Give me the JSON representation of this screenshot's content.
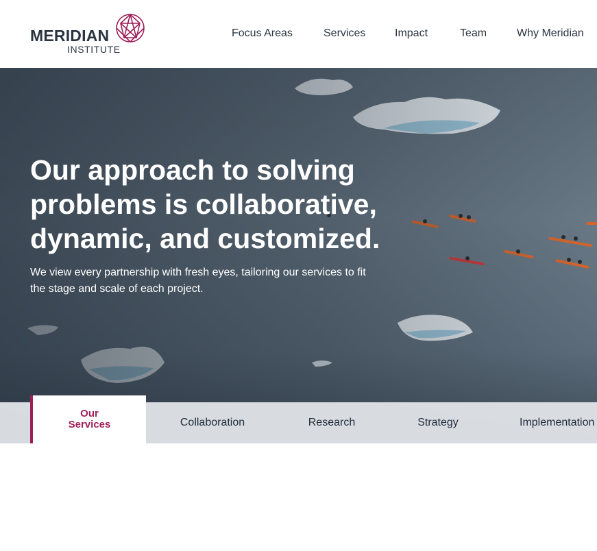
{
  "brand": {
    "name": "MERIDIAN",
    "sub": "INSTITUTE",
    "accent_color": "#9c1f5a"
  },
  "nav": {
    "items": [
      {
        "label": "Focus Areas"
      },
      {
        "label": "Services"
      },
      {
        "label": "Impact"
      },
      {
        "label": "Team"
      },
      {
        "label": "Why Meridian"
      }
    ]
  },
  "hero": {
    "title_line1": "Our approach to solving",
    "title_line2": "problems is collaborative,",
    "title_line3": "dynamic, and customized.",
    "subtitle_line1": "We view every partnership with fresh eyes, tailoring our services to fit",
    "subtitle_line2": "the stage and scale of each project."
  },
  "tabs": {
    "active": "Our Services",
    "items": [
      {
        "label": "Collaboration"
      },
      {
        "label": "Research"
      },
      {
        "label": "Strategy"
      },
      {
        "label": "Implementation"
      }
    ]
  }
}
